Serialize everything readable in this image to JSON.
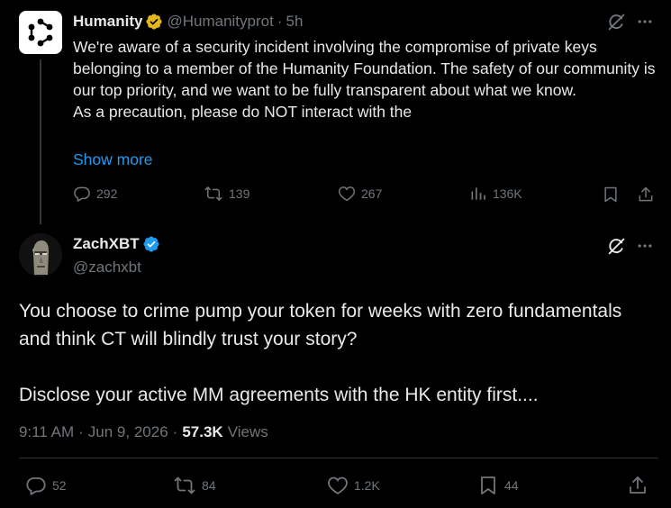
{
  "parent_tweet": {
    "author_name": "Humanity",
    "handle": "@Humanityprot",
    "separator": "·",
    "time": "5h",
    "text_lines": [
      "We're aware of a security incident involving the compromise of private keys belonging to a member of the Humanity Foundation. The safety of our community is our top priority, and we want to be fully transparent about what we know.",
      "As a precaution, please do NOT interact with the"
    ],
    "show_more_label": "Show more",
    "stats": {
      "replies": "292",
      "reposts": "139",
      "likes": "267",
      "views": "136K"
    },
    "badge_color": "#e2b719"
  },
  "main_tweet": {
    "author_name": "ZachXBT",
    "handle": "@zachxbt",
    "text_paragraphs": [
      "You choose to crime pump your token for weeks with zero fundamentals and think CT will blindly trust your story?",
      "Disclose your active MM agreements with the HK entity first...."
    ],
    "time": "9:11 AM",
    "separator": "·",
    "date": "Jun 9, 2026",
    "views_count": "57.3K",
    "views_label": "Views",
    "stats": {
      "replies": "52",
      "reposts": "84",
      "likes": "1.2K",
      "bookmarks": "44"
    },
    "badge_color": "#1d9bf0"
  },
  "colors": {
    "background": "#000000",
    "text_primary": "#e7e9ea",
    "text_secondary": "#71767b",
    "link": "#1d9bf0",
    "divider": "#2f3336"
  },
  "icons": {
    "grok": "grok-icon",
    "more": "more-icon",
    "reply": "reply-icon",
    "repost": "repost-icon",
    "like": "heart-icon",
    "views": "views-icon",
    "bookmark": "bookmark-icon",
    "share": "share-icon"
  }
}
